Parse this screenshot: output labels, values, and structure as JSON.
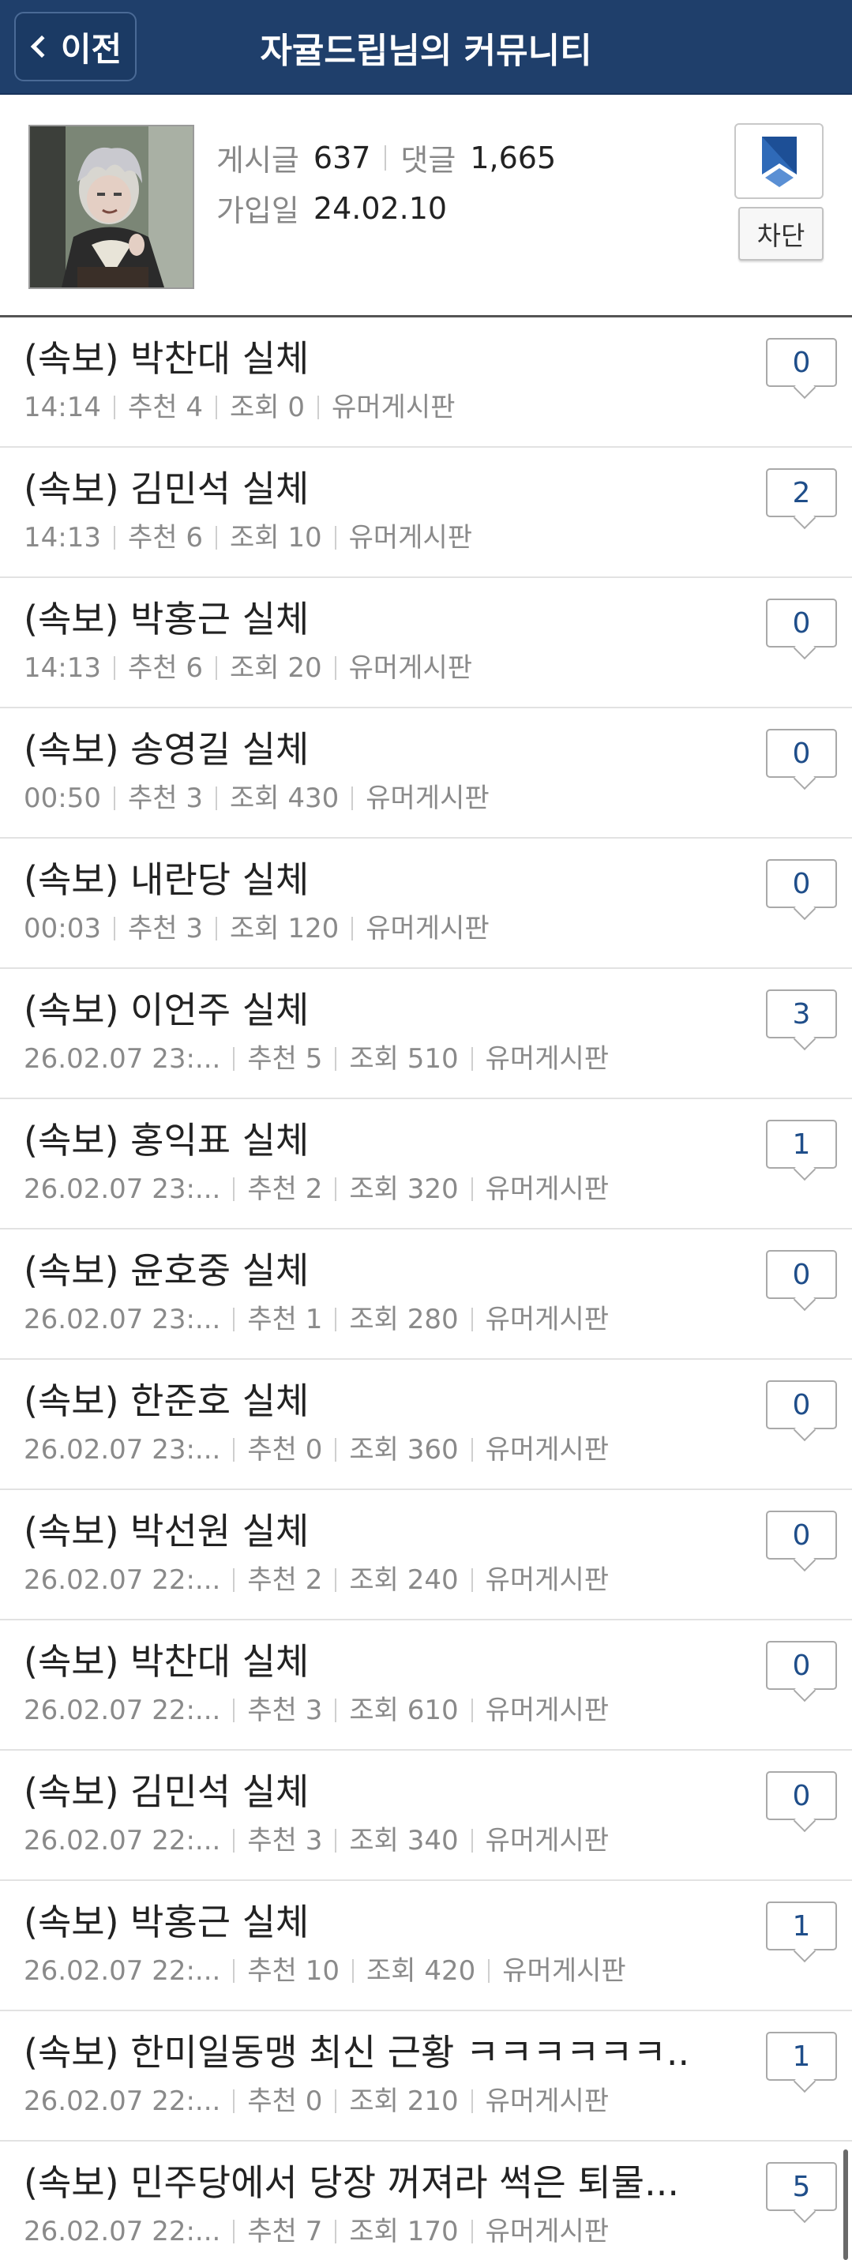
{
  "header": {
    "back_label": "이전",
    "title": "자귤드립님의 커뮤니티"
  },
  "profile": {
    "posts_label": "게시글",
    "posts_value": "637",
    "comments_label": "댓글",
    "comments_value": "1,665",
    "joined_label": "가입일",
    "joined_value": "24.02.10",
    "bookmark_icon": "bookmark-icon",
    "block_label": "차단"
  },
  "posts": [
    {
      "title": "(속보) 박찬대 실체",
      "time": "14:14",
      "recommend": "추천 4",
      "views": "조회 0",
      "board": "유머게시판",
      "comments": "0"
    },
    {
      "title": "(속보) 김민석 실체",
      "time": "14:13",
      "recommend": "추천 6",
      "views": "조회 10",
      "board": "유머게시판",
      "comments": "2"
    },
    {
      "title": "(속보) 박홍근 실체",
      "time": "14:13",
      "recommend": "추천 6",
      "views": "조회 20",
      "board": "유머게시판",
      "comments": "0"
    },
    {
      "title": "(속보) 송영길 실체",
      "time": "00:50",
      "recommend": "추천 3",
      "views": "조회 430",
      "board": "유머게시판",
      "comments": "0"
    },
    {
      "title": "(속보) 내란당 실체",
      "time": "00:03",
      "recommend": "추천 3",
      "views": "조회 120",
      "board": "유머게시판",
      "comments": "0"
    },
    {
      "title": "(속보) 이언주 실체",
      "time": "26.02.07  23:...",
      "recommend": "추천 5",
      "views": "조회 510",
      "board": "유머게시판",
      "comments": "3"
    },
    {
      "title": "(속보) 홍익표 실체",
      "time": "26.02.07  23:...",
      "recommend": "추천 2",
      "views": "조회 320",
      "board": "유머게시판",
      "comments": "1"
    },
    {
      "title": "(속보) 윤호중 실체",
      "time": "26.02.07  23:...",
      "recommend": "추천 1",
      "views": "조회 280",
      "board": "유머게시판",
      "comments": "0"
    },
    {
      "title": "(속보) 한준호 실체",
      "time": "26.02.07  23:...",
      "recommend": "추천 0",
      "views": "조회 360",
      "board": "유머게시판",
      "comments": "0"
    },
    {
      "title": "(속보) 박선원 실체",
      "time": "26.02.07  22:...",
      "recommend": "추천 2",
      "views": "조회 240",
      "board": "유머게시판",
      "comments": "0"
    },
    {
      "title": "(속보) 박찬대 실체",
      "time": "26.02.07  22:...",
      "recommend": "추천 3",
      "views": "조회 610",
      "board": "유머게시판",
      "comments": "0"
    },
    {
      "title": "(속보) 김민석 실체",
      "time": "26.02.07  22:...",
      "recommend": "추천 3",
      "views": "조회 340",
      "board": "유머게시판",
      "comments": "0"
    },
    {
      "title": "(속보) 박홍근 실체",
      "time": "26.02.07  22:...",
      "recommend": "추천 10",
      "views": "조회 420",
      "board": "유머게시판",
      "comments": "1"
    },
    {
      "title": "(속보) 한미일동맹 최신 근황 ㅋㅋㅋㅋㅋㅋ...",
      "time": "26.02.07  22:...",
      "recommend": "추천 0",
      "views": "조회 210",
      "board": "유머게시판",
      "comments": "1"
    },
    {
      "title": "(속보) 민주당에서 당장 꺼져라 썩은 퇴물...",
      "time": "26.02.07  22:...",
      "recommend": "추천 7",
      "views": "조회 170",
      "board": "유머게시판",
      "comments": "5"
    }
  ],
  "colors": {
    "header_bg": "#1f3f6b",
    "comment_count": "#1f4e8a",
    "bookmark_blue": "#2f6ab8"
  }
}
